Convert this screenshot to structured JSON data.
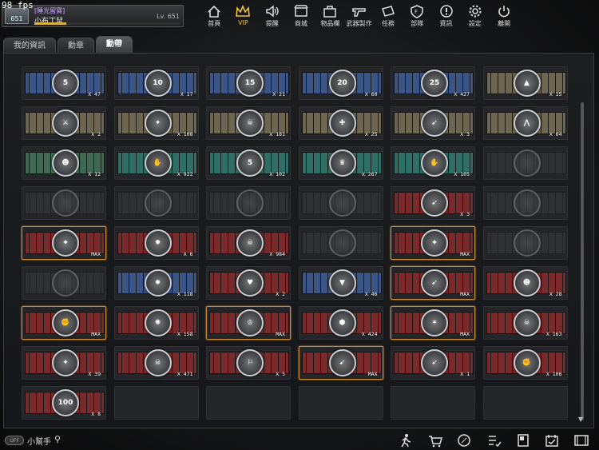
{
  "fps": "98 fps",
  "profile": {
    "clan": "[睡光留寶]",
    "nickname": "小布丁鼠",
    "level": "Lv. 651",
    "rank": "651",
    "xp_progress": 0.22
  },
  "nav": [
    {
      "label": "首頁",
      "icon": "home-icon"
    },
    {
      "label": "VIP",
      "icon": "crown-icon",
      "active": true
    },
    {
      "label": "提醒",
      "icon": "speaker-icon"
    },
    {
      "label": "商城",
      "icon": "shop-icon"
    },
    {
      "label": "物品欄",
      "icon": "bag-icon"
    },
    {
      "label": "武器製作",
      "icon": "gun-icon"
    },
    {
      "label": "任務",
      "icon": "ticket-icon"
    },
    {
      "label": "部隊",
      "icon": "shield-icon"
    },
    {
      "label": "資訊",
      "icon": "info-icon"
    },
    {
      "label": "設定",
      "icon": "gear-icon"
    },
    {
      "label": "離開",
      "icon": "power-icon"
    }
  ],
  "tabs": [
    {
      "label": "我的資訊",
      "active": false
    },
    {
      "label": "勳章",
      "active": false
    },
    {
      "label": "勳帶",
      "active": true
    }
  ],
  "ribbon_colors": {
    "blue": "#3a5586",
    "tan": "#6e6651",
    "green": "#3f6b55",
    "teal": "#2f6f66",
    "red": "#7a2a2a",
    "gray": "#4a4b4e"
  },
  "ribbons": [
    {
      "style": "blue",
      "emblem": "5",
      "count": "X 47"
    },
    {
      "style": "blue",
      "emblem": "10",
      "count": "X 17"
    },
    {
      "style": "blue",
      "emblem": "15",
      "count": "X 21"
    },
    {
      "style": "blue",
      "emblem": "20",
      "count": "X 60"
    },
    {
      "style": "blue",
      "emblem": "25",
      "count": "X 427"
    },
    {
      "style": "tan",
      "emblem": "▲",
      "count": "X 15"
    },
    {
      "style": "tan",
      "emblem": "⚔",
      "count": "X 2"
    },
    {
      "style": "tan",
      "emblem": "✦",
      "count": "X 108"
    },
    {
      "style": "tan",
      "emblem": "☠",
      "count": "X 181"
    },
    {
      "style": "tan",
      "emblem": "✚",
      "count": "X 25"
    },
    {
      "style": "tan",
      "emblem": "➹",
      "count": "X 3"
    },
    {
      "style": "tan",
      "emblem": "⋀",
      "count": "X 64"
    },
    {
      "style": "green",
      "emblem": "☻",
      "count": "X 12"
    },
    {
      "style": "teal",
      "emblem": "✋",
      "count": "X 922"
    },
    {
      "style": "teal",
      "emblem": "5",
      "count": "X 102"
    },
    {
      "style": "teal",
      "emblem": "♛",
      "count": "X 267"
    },
    {
      "style": "teal",
      "emblem": "✋",
      "count": "X 105"
    },
    {
      "style": "gray",
      "emblem": "",
      "count": "",
      "locked": true
    },
    {
      "style": "gray",
      "emblem": "",
      "count": "",
      "locked": true
    },
    {
      "style": "gray",
      "emblem": "",
      "count": "",
      "locked": true
    },
    {
      "style": "gray",
      "emblem": "",
      "count": "",
      "locked": true
    },
    {
      "style": "gray",
      "emblem": "",
      "count": "",
      "locked": true
    },
    {
      "style": "red",
      "emblem": "➹",
      "count": "X 3"
    },
    {
      "style": "gray",
      "emblem": "",
      "count": "",
      "locked": true
    },
    {
      "style": "red",
      "emblem": "⌖",
      "count": "MAX",
      "max": true
    },
    {
      "style": "red",
      "emblem": "✹",
      "count": "X 6"
    },
    {
      "style": "red",
      "emblem": "☠",
      "count": "X 984"
    },
    {
      "style": "gray",
      "emblem": "",
      "count": "",
      "locked": true
    },
    {
      "style": "red",
      "emblem": "⌖",
      "count": "MAX",
      "max": true
    },
    {
      "style": "gray",
      "emblem": "",
      "count": "",
      "locked": true
    },
    {
      "style": "gray",
      "emblem": "",
      "count": "",
      "locked": true
    },
    {
      "style": "blue",
      "emblem": "✸",
      "count": "X 118"
    },
    {
      "style": "red",
      "emblem": "♥",
      "count": "X 2"
    },
    {
      "style": "blue",
      "emblem": "▼",
      "count": "X 46"
    },
    {
      "style": "red",
      "emblem": "➹",
      "count": "MAX",
      "max": true
    },
    {
      "style": "red",
      "emblem": "☻",
      "count": "X 28"
    },
    {
      "style": "red",
      "emblem": "✊",
      "count": "MAX",
      "max": true
    },
    {
      "style": "red",
      "emblem": "✺",
      "count": "X 158"
    },
    {
      "style": "red",
      "emblem": "♔",
      "count": "MAX",
      "max": true
    },
    {
      "style": "red",
      "emblem": "⬢",
      "count": "X 424"
    },
    {
      "style": "red",
      "emblem": "✶",
      "count": "MAX",
      "max": true
    },
    {
      "style": "red",
      "emblem": "☠",
      "count": "X 163"
    },
    {
      "style": "red",
      "emblem": "✦",
      "count": "X 39"
    },
    {
      "style": "red",
      "emblem": "☠",
      "count": "X 471"
    },
    {
      "style": "red",
      "emblem": "⚐",
      "count": "X 5"
    },
    {
      "style": "red",
      "emblem": "➹",
      "count": "MAX",
      "max": true
    },
    {
      "style": "red",
      "emblem": "➶",
      "count": "X 1"
    },
    {
      "style": "red",
      "emblem": "✊",
      "count": "X 106"
    },
    {
      "style": "red",
      "emblem": "100",
      "count": "X 8"
    },
    {
      "style": "empty"
    },
    {
      "style": "empty"
    },
    {
      "style": "empty"
    },
    {
      "style": "empty"
    },
    {
      "style": "empty"
    }
  ],
  "bottom": {
    "toggle": "OFF",
    "helper_label": "小幫手"
  },
  "bottom_icons": [
    "runner-icon",
    "cart-icon",
    "compass-icon",
    "checklist-icon",
    "bookmark-icon",
    "calendar-icon",
    "film-icon"
  ]
}
